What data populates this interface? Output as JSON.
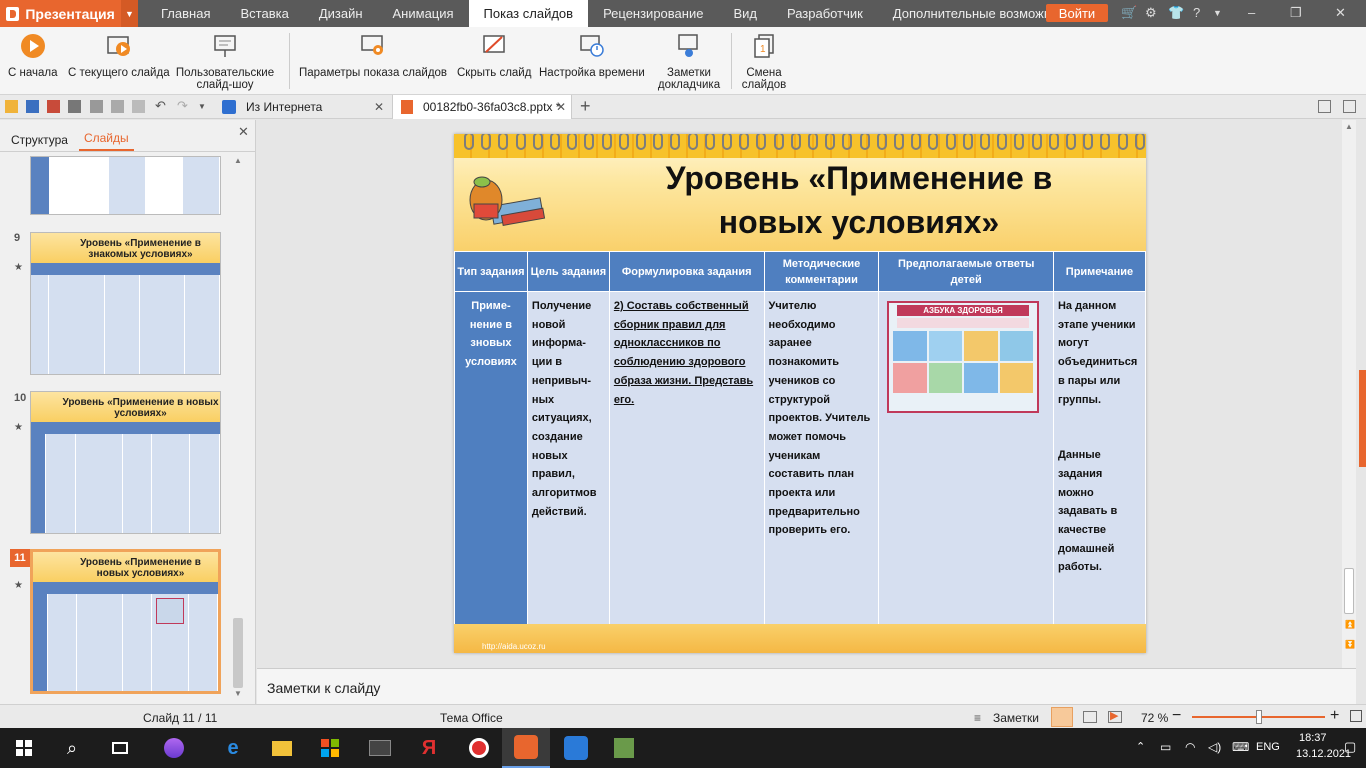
{
  "app": {
    "name": "Презентация"
  },
  "menu": {
    "items": [
      "Главная",
      "Вставка",
      "Дизайн",
      "Анимация",
      "Показ слайдов",
      "Рецензирование",
      "Вид",
      "Разработчик",
      "Дополнительные возможности"
    ],
    "active_index": 4,
    "login_label": "Войти"
  },
  "ribbon": {
    "from_start": "С начала",
    "from_current": "С текущего слайда",
    "custom_show": "Пользовательские слайд-шоу",
    "show_settings": "Параметры показа слайдов",
    "hide_slide": "Скрыть слайд",
    "rehearse_timings": "Настройка времени",
    "speaker_notes": "Заметки докладчика",
    "switch_slides": "Смена слайдов"
  },
  "tabs": {
    "internet": "Из Интернета",
    "document": "00182fb0-36fa03c8.pptx *"
  },
  "left_pane": {
    "tab_structure": "Структура",
    "tab_slides": "Слайды",
    "thumbnails": [
      {
        "number": "9",
        "title": "Уровень «Применение в знакомых условиях»"
      },
      {
        "number": "10",
        "title": "Уровень «Применение в новых условиях»"
      },
      {
        "number": "11",
        "title": "Уровень «Применение в новых условиях»"
      }
    ]
  },
  "slide": {
    "title": "Уровень «Применение в новых условиях»",
    "url": "http://aida.ucoz.ru",
    "poster_title": "АЗБУКА ЗДОРОВЬЯ",
    "headers": [
      "Тип задания",
      "Цель задания",
      "Формулировка задания",
      "Методические комментарии",
      "Предполагаемые ответы детей",
      "Примечание"
    ],
    "row": {
      "type": "Приме- нение в зновых условиях",
      "goal": "Получение новой информа- ции в непривыч- ных ситуациях, создание новых правил, алгоритмов действий.",
      "task": "2) Составь собственный сборник правил для одноклассников по соблюдению здорового образа жизни. Представь его.",
      "comments": "Учителю необходимо заранее познакомить учеников со структурой проектов. Учитель может помочь ученикам составить план проекта или предварительно проверить его.",
      "note_1": "На данном этапе ученики могут объединиться в пары или группы.",
      "note_2": "Данные задания можно задавать в качестве домашней работы."
    }
  },
  "notes": {
    "placeholder": "Заметки к слайду"
  },
  "status": {
    "slide_counter": "Слайд 11 / 11",
    "theme": "Тема Office",
    "notes_label": "Заметки",
    "zoom": "72 %",
    "zoom_level": 0.5
  },
  "taskbar": {
    "time": "18:37",
    "date": "13.12.2021",
    "lang": "ENG"
  },
  "colors": {
    "accent": "#e8662e",
    "table_header": "#4f7fc0",
    "table_cell": "#d6dff0"
  }
}
